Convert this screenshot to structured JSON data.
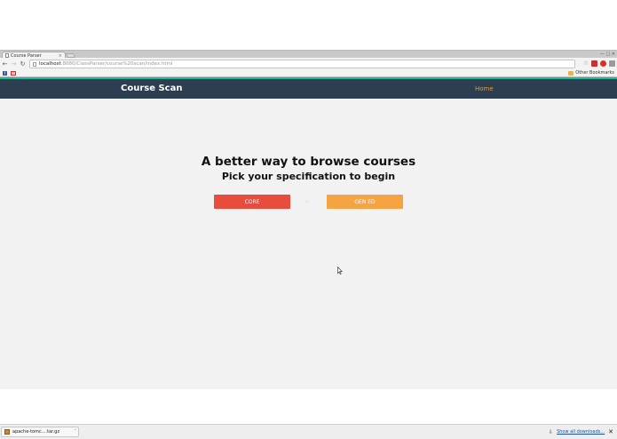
{
  "browser": {
    "tab_title": "Course Parser",
    "tab_close": "×",
    "window_controls": "— ▢ ✕",
    "url_host": "localhost",
    "url_path": ":8080/ClassParser/course%20scan/index.html",
    "back_glyph": "←",
    "forward_glyph": "→",
    "reload_glyph": "↻",
    "star_glyph": "☆",
    "bookmarks": {
      "facebook_glyph": "f",
      "gmail_glyph": "M",
      "other_label": "Other Bookmarks"
    }
  },
  "site": {
    "brand": "Course Scan",
    "nav_home": "Home",
    "colors": {
      "header": "#2c3e50",
      "accent": "#18bc9c",
      "core": "#e74c3c",
      "gened": "#f5a343",
      "home": "#f39c12"
    }
  },
  "hero": {
    "title": "A better way to browse courses",
    "subtitle": "Pick your specification to begin",
    "core_label": "CORE",
    "divider": "or",
    "gened_label": "GEN ED"
  },
  "downloads": {
    "file_name": "apache-tomc....tar.gz",
    "caret": "˅",
    "arrow_glyph": "⇩",
    "show_all": "Show all downloads...",
    "close_glyph": "✕"
  },
  "icons": [
    "page-icon",
    "back-icon",
    "forward-icon",
    "reload-icon",
    "star-icon",
    "extension-icon",
    "facebook-icon",
    "gmail-icon",
    "folder-icon",
    "archive-icon",
    "download-arrow-icon",
    "close-icon",
    "cursor-icon"
  ]
}
